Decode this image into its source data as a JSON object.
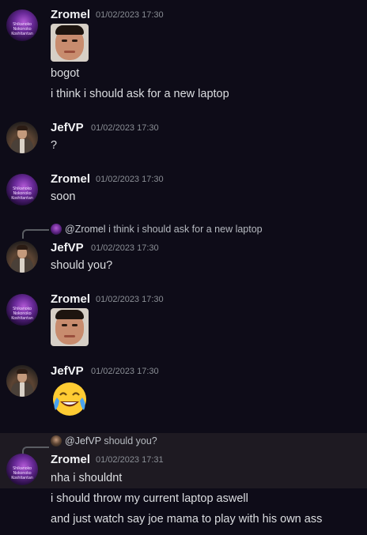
{
  "messages": [
    {
      "author": "Zromel",
      "timestamp": "01/02/2023 17:30",
      "avatar_text": "Shikanoko Nokonoko Koshitantan",
      "lines": [
        "bogot",
        "i think i should ask for a new laptop"
      ]
    },
    {
      "author": "JefVP",
      "timestamp": "01/02/2023 17:30",
      "lines": [
        "?"
      ]
    },
    {
      "author": "Zromel",
      "timestamp": "01/02/2023 17:30",
      "lines": [
        "soon"
      ]
    },
    {
      "reply_to_author": "@Zromel",
      "reply_to_text": "i think i should ask for a new laptop",
      "author": "JefVP",
      "timestamp": "01/02/2023 17:30",
      "lines": [
        "should you?"
      ]
    },
    {
      "author": "Zromel",
      "timestamp": "01/02/2023 17:30",
      "lines": []
    },
    {
      "author": "JefVP",
      "timestamp": "01/02/2023 17:30",
      "lines": []
    },
    {
      "reply_to_author": "@JefVP",
      "reply_to_text": "should you?",
      "author": "Zromel",
      "timestamp": "01/02/2023 17:31",
      "lines": [
        "nha i shouldnt",
        "i should throw my current laptop aswell",
        "and just watch say joe mama to play with his own ass"
      ]
    }
  ],
  "icons": {
    "zromel_avatar": "purple-galaxy-avatar",
    "jef_avatar": "man-in-suit-avatar",
    "face_sticker": "face-photo-sticker",
    "laugh_emoji": "face-with-tears-of-joy-emoji"
  },
  "colors": {
    "background": "#0e0c18",
    "highlight_background": "#1e1a22",
    "username": "#f2f3f5",
    "timestamp": "#8a8e95",
    "message_text": "#dcdee1"
  }
}
